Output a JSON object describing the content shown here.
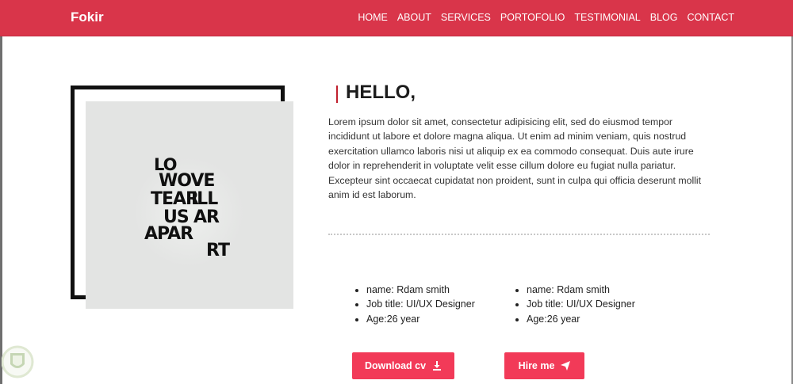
{
  "header": {
    "brand": "Fokir",
    "nav": [
      {
        "label": "HOME",
        "active": true
      },
      {
        "label": "ABOUT"
      },
      {
        "label": "SERVICES"
      },
      {
        "label": "PORTOFOLIO"
      },
      {
        "label": "TESTIMONIAL"
      },
      {
        "label": "BLOG"
      },
      {
        "label": "CONTACT"
      }
    ]
  },
  "poster": {
    "lines": [
      "LO",
      "WOVE",
      "TEAR",
      "ILL",
      "US",
      "AR",
      "APAR",
      "RT"
    ]
  },
  "about": {
    "heading": "HELLO,",
    "bio": "Lorem ipsum dolor sit amet, consectetur adipisicing elit, sed do eiusmod tempor incididunt ut labore et dolore magna aliqua. Ut enim ad minim veniam, quis nostrud exercitation ullamco laboris nisi ut aliquip ex ea commodo consequat. Duis aute irure dolor in reprehenderit in voluptate velit esse cillum dolore eu fugiat nulla pariatur. Excepteur sint occaecat cupidatat non proident, sunt in culpa qui officia deserunt mollit anim id est laborum.",
    "info_left": [
      "name: Rdam smith",
      "Job title: UI/UX Designer",
      "Age:26 year"
    ],
    "info_right": [
      "name: Rdam smith",
      "Job title: UI/UX Designer",
      "Age:26 year"
    ],
    "buttons": {
      "download_cv": "Download cv",
      "hire_me": "Hire me"
    }
  },
  "colors": {
    "navbar": "#d9354a",
    "accent": "#f23a58",
    "heading_bar": "#c0202e"
  },
  "icons": {
    "download": "download-icon",
    "send": "paper-plane-icon"
  }
}
